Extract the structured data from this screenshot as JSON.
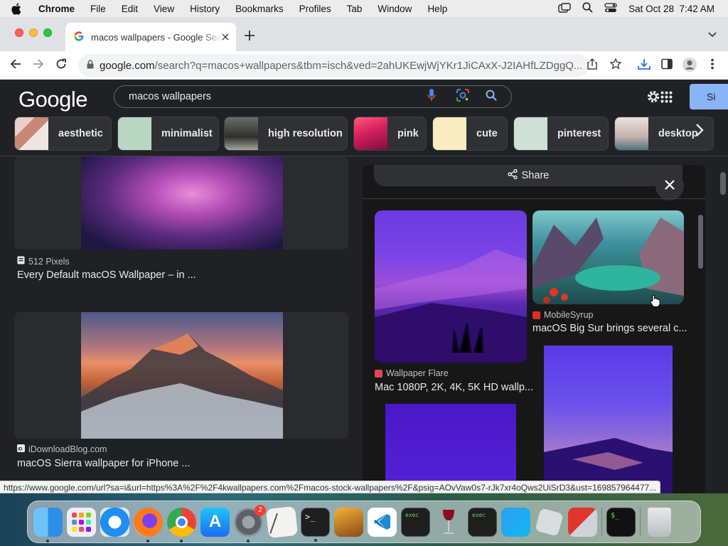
{
  "menubar": {
    "app": "Chrome",
    "items": [
      "File",
      "Edit",
      "View",
      "History",
      "Bookmarks",
      "Profiles",
      "Tab",
      "Window",
      "Help"
    ],
    "datetime": "Sat Oct 28  7:42 AM"
  },
  "browser": {
    "tab_title": "macos wallpapers - Google Search",
    "url_host": "google.com",
    "url_rest": "/search?q=macos+wallpapers&tbm=isch&ved=2ahUKEwjWjYKr1JiCAxX-J2IAHfLZDggQ...",
    "status_url": "https://www.google.com/url?sa=i&url=https%3A%2F%2F4kwallpapers.com%2Fmacos-stock-wallpapers%2F&psig=AOvVaw0s7-rJk7xr4oQws2UiSrD3&ust=169857964477..."
  },
  "google": {
    "logo": "Google",
    "query": "macos wallpapers",
    "signin": "Si",
    "chips": [
      "aesthetic",
      "minimalist",
      "high resolution",
      "pink",
      "cute",
      "pinterest",
      "desktop"
    ]
  },
  "results": [
    {
      "source": "512 Pixels",
      "title": "Every Default macOS Wallpaper – in ..."
    },
    {
      "source": "iDownloadBlog.com",
      "title": "macOS Sierra wallpaper for iPhone ..."
    }
  ],
  "panel": {
    "share": "Share",
    "related": [
      {
        "source": "Wallpaper Flare",
        "title": "Mac 1080P, 2K, 4K, 5K HD wallp..."
      },
      {
        "source": "MobileSyrup",
        "title": "macOS Big Sur brings several c..."
      }
    ]
  },
  "dock": {
    "badge_settings": "2",
    "apps": [
      "Finder",
      "Launchpad",
      "Safari",
      "Firefox",
      "Chrome",
      "App Store",
      "System Settings",
      "Script Editor",
      "Terminal",
      "Instruments",
      "VS Code",
      "Exec",
      "Wine",
      "Exec 2",
      "Xcode Cloud",
      "Roblox",
      "Parallels",
      "Terminal 2",
      "Trash"
    ]
  },
  "colors": {
    "accent": "#8ab4f8",
    "background": "#202124"
  }
}
